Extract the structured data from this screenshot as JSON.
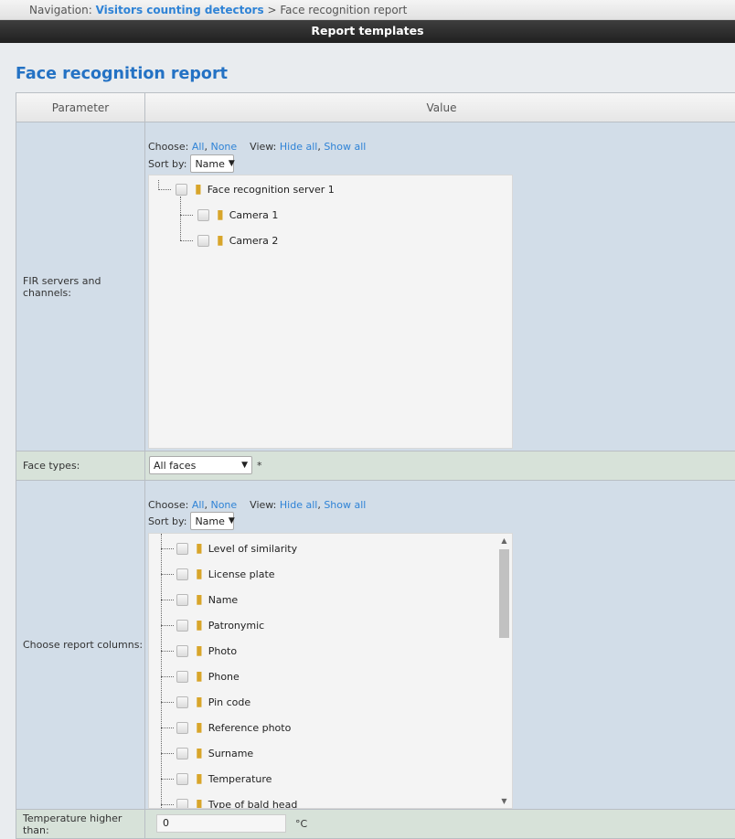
{
  "breadcrumb": {
    "prefix": "Navigation:",
    "link": "Visitors counting detectors",
    "separator": ">",
    "current": "Face recognition report"
  },
  "header": {
    "title": "Report templates"
  },
  "page": {
    "title": "Face recognition report"
  },
  "table": {
    "param_header": "Parameter",
    "value_header": "Value"
  },
  "servers": {
    "label": "FIR servers and channels:",
    "choose_label": "Choose:",
    "all": "All",
    "none": "None",
    "view_label": "View:",
    "hide_all": "Hide all",
    "show_all": "Show all",
    "sort_label": "Sort by:",
    "sort_value": "Name",
    "tree": {
      "root": "Face recognition server 1",
      "children": [
        "Camera 1",
        "Camera 2"
      ]
    }
  },
  "face_types": {
    "label": "Face types:",
    "value": "All faces",
    "required_mark": "*"
  },
  "columns": {
    "label": "Choose report columns:",
    "choose_label": "Choose:",
    "all": "All",
    "none": "None",
    "view_label": "View:",
    "hide_all": "Hide all",
    "show_all": "Show all",
    "sort_label": "Sort by:",
    "sort_value": "Name",
    "items": [
      "Level of similarity",
      "License plate",
      "Name",
      "Patronymic",
      "Photo",
      "Phone",
      "Pin code",
      "Reference photo",
      "Surname",
      "Temperature",
      "Type of bald head"
    ]
  },
  "temperature": {
    "label": "Temperature higher than:",
    "value": "0",
    "unit": "°C"
  }
}
